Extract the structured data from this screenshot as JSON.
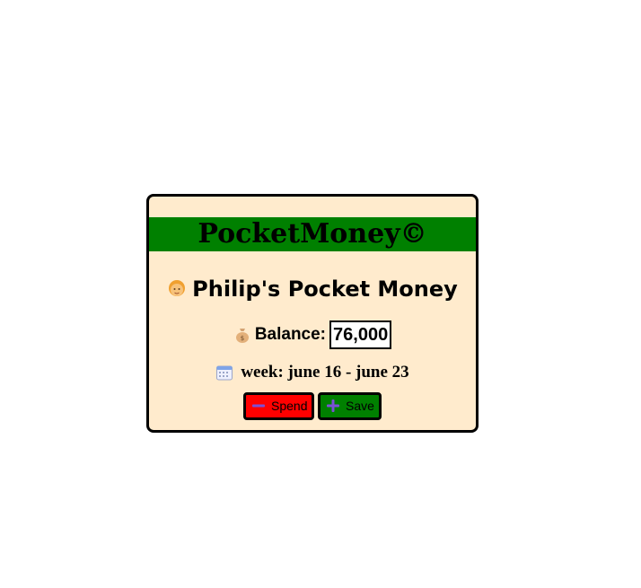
{
  "app": {
    "title": "PocketMoney©"
  },
  "owner": {
    "title": "Philip's Pocket Money",
    "icon": "person-face-icon"
  },
  "balance": {
    "label": "Balance:",
    "value": "76,000",
    "icon": "money-bag-icon"
  },
  "week": {
    "text": "week: june 16 - june 23",
    "icon": "calendar-icon"
  },
  "actions": {
    "spend_label": "Spend",
    "save_label": "Save",
    "spend_icon": "minus-icon",
    "save_icon": "plus-icon"
  },
  "colors": {
    "banner": "#008000",
    "card_background": "#ffebcd",
    "spend_button": "#ff0000",
    "save_button": "#008000",
    "button_icon": "#7b4fd6"
  }
}
